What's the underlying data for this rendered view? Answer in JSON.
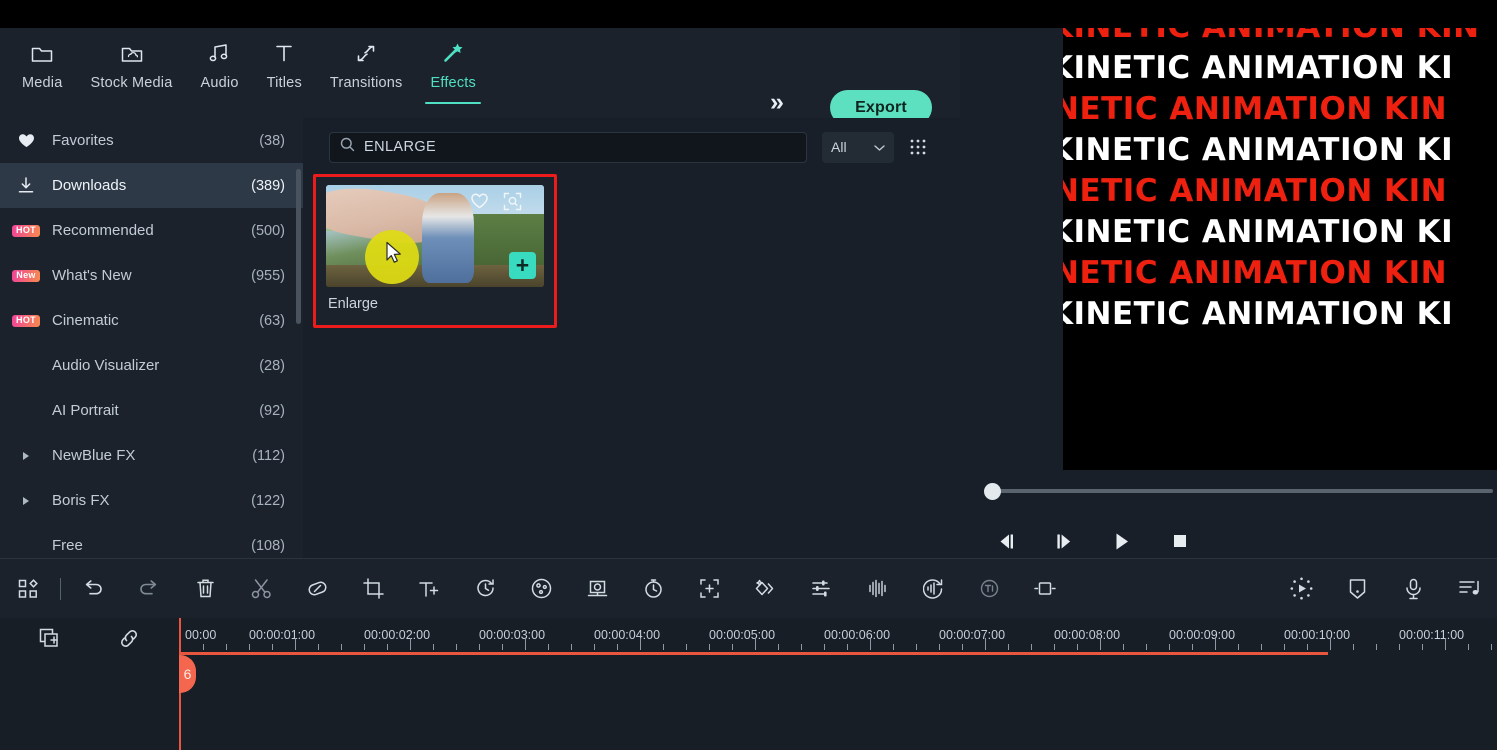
{
  "app": {
    "accent": "#4fe0c3",
    "selection_border": "#ec1c1c",
    "playhead_color": "#e8563f"
  },
  "topnav": {
    "tabs": [
      {
        "label": "Media",
        "icon": "folder-icon"
      },
      {
        "label": "Stock Media",
        "icon": "folder-cloud-icon"
      },
      {
        "label": "Audio",
        "icon": "music-notes-icon"
      },
      {
        "label": "Titles",
        "icon": "text-t-icon"
      },
      {
        "label": "Transitions",
        "icon": "transitions-arrows-icon"
      },
      {
        "label": "Effects",
        "icon": "magic-wand-icon"
      }
    ],
    "active_tab": "Effects",
    "more_label": "»",
    "export_label": "Export"
  },
  "sidebar": {
    "items": [
      {
        "label": "Favorites",
        "count": "(38)",
        "icon": "heart-icon",
        "badge": "",
        "selected": false,
        "expandable": false
      },
      {
        "label": "Downloads",
        "count": "(389)",
        "icon": "download-icon",
        "badge": "",
        "selected": true,
        "expandable": false
      },
      {
        "label": "Recommended",
        "count": "(500)",
        "icon": "",
        "badge": "HOT",
        "selected": false,
        "expandable": false
      },
      {
        "label": "What's New",
        "count": "(955)",
        "icon": "",
        "badge": "New",
        "selected": false,
        "expandable": false
      },
      {
        "label": "Cinematic",
        "count": "(63)",
        "icon": "",
        "badge": "HOT",
        "selected": false,
        "expandable": false
      },
      {
        "label": "Audio Visualizer",
        "count": "(28)",
        "icon": "",
        "badge": "",
        "selected": false,
        "expandable": false
      },
      {
        "label": "AI Portrait",
        "count": "(92)",
        "icon": "",
        "badge": "",
        "selected": false,
        "expandable": false
      },
      {
        "label": "NewBlue FX",
        "count": "(112)",
        "icon": "",
        "badge": "",
        "selected": false,
        "expandable": true
      },
      {
        "label": "Boris FX",
        "count": "(122)",
        "icon": "",
        "badge": "",
        "selected": false,
        "expandable": true
      },
      {
        "label": "Free",
        "count": "(108)",
        "icon": "",
        "badge": "",
        "selected": false,
        "expandable": false
      }
    ]
  },
  "browser": {
    "search": {
      "value": "ENLARGE",
      "placeholder": "Search",
      "icon": "search-icon"
    },
    "filter": {
      "value": "All",
      "chevron": "chevron-down-icon"
    },
    "view_toggle": "grid-view-icon",
    "effects": [
      {
        "title": "Enlarge",
        "selected": true,
        "favorite_icon": "heart-outline-icon",
        "preview_icon": "preview-frame-icon",
        "add_label": "+"
      }
    ]
  },
  "preview": {
    "canvas_text_lines": [
      "KINETIC ANIMATION KIN",
      "KINETIC ANIMATION KI",
      "INETIC ANIMATION KIN",
      "KINETIC ANIMATION KI",
      "INETIC ANIMATION KIN",
      "KINETIC ANIMATION KI",
      "INETIC ANIMATION KIN",
      "KINETIC ANIMATION KI"
    ],
    "text_color_white": "#ffffff",
    "text_color_red": "#ee2010",
    "seek_position_percent": 1,
    "controls": [
      {
        "name": "previous-frame-button",
        "icon": "step-backward-icon"
      },
      {
        "name": "next-frame-button",
        "icon": "step-forward-icon"
      },
      {
        "name": "play-button",
        "icon": "play-icon"
      },
      {
        "name": "stop-button",
        "icon": "stop-icon"
      }
    ]
  },
  "toolbar": {
    "items": [
      {
        "name": "layout-grid-button",
        "icon": "layout-grid-icon"
      },
      {
        "name": "separator",
        "icon": "separator"
      },
      {
        "name": "undo-button",
        "icon": "undo-icon"
      },
      {
        "name": "redo-button",
        "icon": "redo-icon"
      },
      {
        "name": "delete-button",
        "icon": "trash-icon"
      },
      {
        "name": "split-button",
        "icon": "scissors-icon"
      },
      {
        "name": "marker-button",
        "icon": "tag-icon"
      },
      {
        "name": "crop-button",
        "icon": "crop-icon"
      },
      {
        "name": "add-text-button",
        "icon": "text-plus-icon"
      },
      {
        "name": "speed-button",
        "icon": "speed-clock-icon"
      },
      {
        "name": "color-match-button",
        "icon": "color-wheel-icon"
      },
      {
        "name": "green-screen-button",
        "icon": "green-screen-icon"
      },
      {
        "name": "snapshot-button",
        "icon": "stopwatch-icon"
      },
      {
        "name": "add-keyframe-button",
        "icon": "keyframe-plus-icon"
      },
      {
        "name": "effects-button",
        "icon": "effects-diamond-icon"
      },
      {
        "name": "adjust-button",
        "icon": "sliders-icon"
      },
      {
        "name": "audio-waveform-button",
        "icon": "audio-waveform-icon"
      },
      {
        "name": "audio-ducking-button",
        "icon": "audio-ducking-icon"
      },
      {
        "name": "text-to-speech-button",
        "icon": "text-to-speech-icon"
      },
      {
        "name": "silence-detection-button",
        "icon": "silence-detect-icon"
      }
    ],
    "right_items": [
      {
        "name": "render-preview-button",
        "icon": "render-preview-icon"
      },
      {
        "name": "marker-add-button",
        "icon": "marker-shield-icon"
      },
      {
        "name": "record-voiceover-button",
        "icon": "microphone-icon"
      },
      {
        "name": "audio-list-button",
        "icon": "audio-list-icon"
      }
    ]
  },
  "timeline": {
    "head_icons": [
      {
        "name": "add-track-button",
        "icon": "add-media-icon"
      },
      {
        "name": "link-clips-button",
        "icon": "link-icon"
      }
    ],
    "ruler_labels": [
      "00:00",
      "00:00:01:00",
      "00:00:02:00",
      "00:00:03:00",
      "00:00:04:00",
      "00:00:05:00",
      "00:00:06:00",
      "00:00:07:00",
      "00:00:08:00",
      "00:00:09:00",
      "00:00:10:00",
      "00:00:11:00"
    ],
    "playhead_label": "6",
    "playhead_time": "00:00"
  }
}
